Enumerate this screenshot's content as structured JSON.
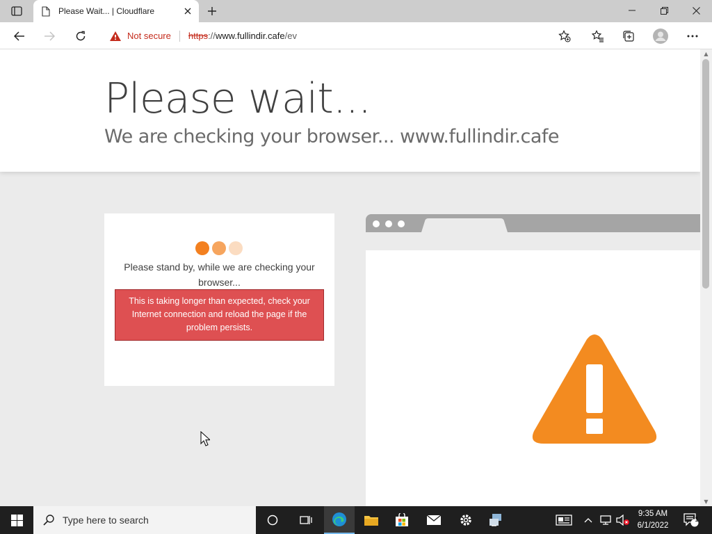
{
  "browser": {
    "tab": {
      "title": "Please Wait... | Cloudflare"
    },
    "address": {
      "security_label": "Not secure",
      "url_scheme": "https",
      "url_sep": "://",
      "url_host": "www.fullindir.cafe",
      "url_path": "/ev"
    },
    "icons": [
      "tab-actions-icon",
      "page-icon",
      "close-icon",
      "plus-icon",
      "minimize-icon",
      "restore-icon",
      "close-window-icon",
      "back-icon",
      "forward-icon",
      "refresh-icon",
      "warning-triangle-icon",
      "add-favorite-icon",
      "favorites-icon",
      "collections-icon",
      "profile-avatar-icon",
      "more-icon"
    ]
  },
  "page": {
    "title": "Please wait...",
    "subtitle": "We are checking your browser... www.fullindir.cafe",
    "standby_text": "Please stand by, while we are checking your browser...",
    "alert_text": "This is taking longer than expected, check your Internet connection and reload the page if the problem persists.",
    "colors": {
      "dot1": "#f38020",
      "dot2": "#f6a55e",
      "dot3": "#fbdcc1",
      "alert_bg": "#de5052",
      "warning_orange": "#f38b20"
    }
  },
  "taskbar": {
    "search_placeholder": "Type here to search",
    "time": "9:35 AM",
    "date": "6/1/2022",
    "notification_count": "1",
    "apps": [
      "start-icon",
      "cortana-icon",
      "task-view-icon",
      "edge-icon",
      "file-explorer-icon",
      "store-icon",
      "mail-icon",
      "settings-icon",
      "network-app-icon"
    ]
  }
}
